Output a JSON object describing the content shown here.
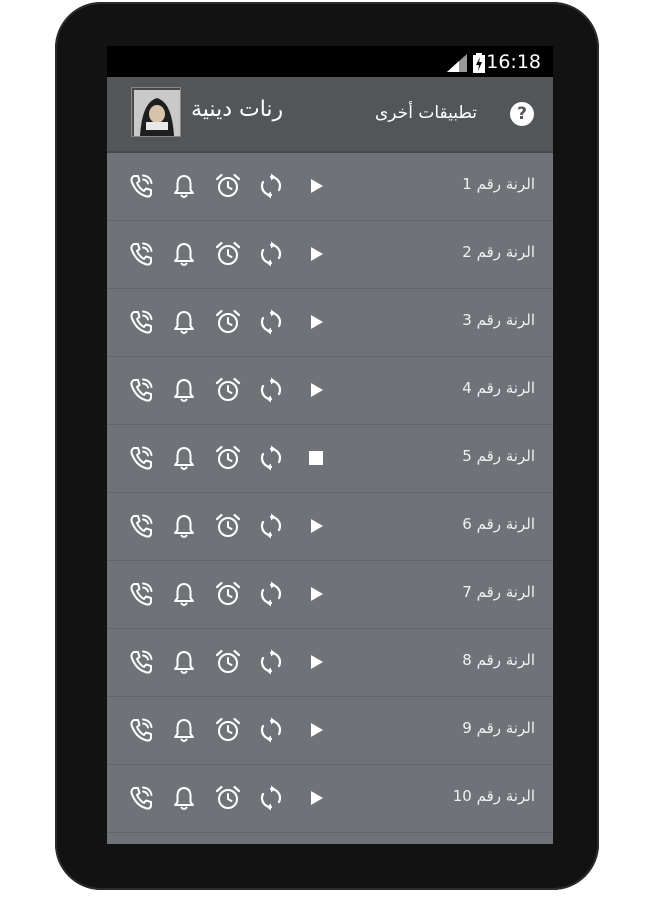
{
  "status_bar": {
    "time": "16:18"
  },
  "action_bar": {
    "title": "رنات دينية",
    "other_apps": "تطبيقات أخرى",
    "help_symbol": "?"
  },
  "ringtones": [
    {
      "label": "الرنة رقم 1",
      "playing": false
    },
    {
      "label": "الرنة رقم 2",
      "playing": false
    },
    {
      "label": "الرنة رقم 3",
      "playing": false
    },
    {
      "label": "الرنة رقم 4",
      "playing": false
    },
    {
      "label": "الرنة رقم 5",
      "playing": true
    },
    {
      "label": "الرنة رقم 6",
      "playing": false
    },
    {
      "label": "الرنة رقم 7",
      "playing": false
    },
    {
      "label": "الرنة رقم 8",
      "playing": false
    },
    {
      "label": "الرنة رقم 9",
      "playing": false
    },
    {
      "label": "الرنة رقم 10",
      "playing": false
    }
  ],
  "row_icons": [
    "set-ringtone-icon",
    "notification-icon",
    "alarm-icon",
    "repeat-icon",
    "play-icon",
    "stop-icon"
  ],
  "colors": {
    "screen_bg": "#6f7378",
    "action_bar": "#535659",
    "icon": "#ffffff"
  }
}
